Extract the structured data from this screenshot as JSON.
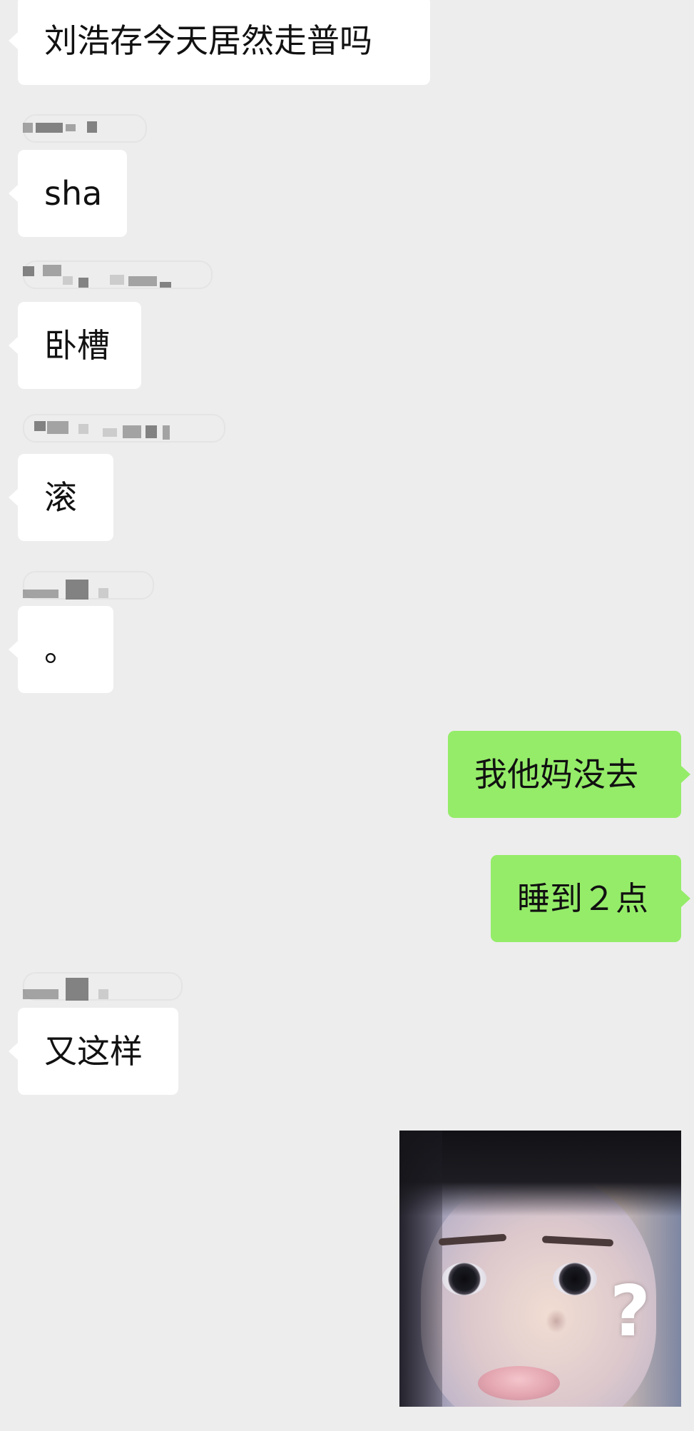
{
  "chat": {
    "messages": [
      {
        "direction": "incoming",
        "text": "刘浩存今天居然走普吗"
      },
      {
        "direction": "incoming",
        "text": "sha"
      },
      {
        "direction": "incoming",
        "text": "卧槽"
      },
      {
        "direction": "incoming",
        "text": "滚"
      },
      {
        "direction": "incoming",
        "text": "。"
      },
      {
        "direction": "outgoing",
        "text": "我他妈没去"
      },
      {
        "direction": "outgoing",
        "text": "睡到２点"
      },
      {
        "direction": "incoming",
        "text": "又这样"
      },
      {
        "direction": "outgoing",
        "sticker": "confused-face-sticker",
        "text": "?"
      }
    ]
  },
  "colors": {
    "background": "#ededed",
    "incoming_bubble": "#ffffff",
    "outgoing_bubble": "#95ec69",
    "text": "#111111"
  }
}
